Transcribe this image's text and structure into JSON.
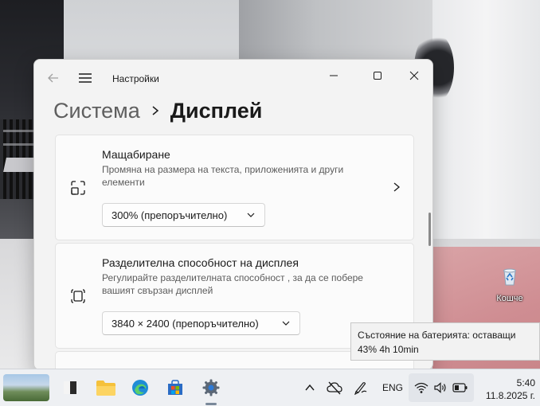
{
  "window": {
    "app_title": "Настройки",
    "breadcrumb_parent": "Система",
    "breadcrumb_current": "Дисплей"
  },
  "scale": {
    "title": "Мащабиране",
    "description": "Промяна на размера на текста, приложенията и други елементи",
    "value": "300% (препоръчително)",
    "icon": "scale-icon"
  },
  "resolution": {
    "title": "Разделителна способност на дисплея",
    "description": "Регулирайте разделителната способност , за да се побере вашият свързан дисплей",
    "value": "3840 × 2400 (препоръчително)",
    "icon": "resolution-icon"
  },
  "desktop": {
    "recycle_bin_label": "Кошче"
  },
  "tooltip": {
    "text": "Състояние на батерията: оставащи 43% 4h 10min"
  },
  "taskbar": {
    "language": "ENG",
    "time": "5:40",
    "date": "11.8.2025 г."
  },
  "colors": {
    "accent": "#0067c0",
    "window_bg": "#f3f3f3",
    "card_bg": "#fbfbfb",
    "taskbar_bg": "#eef0f3"
  }
}
